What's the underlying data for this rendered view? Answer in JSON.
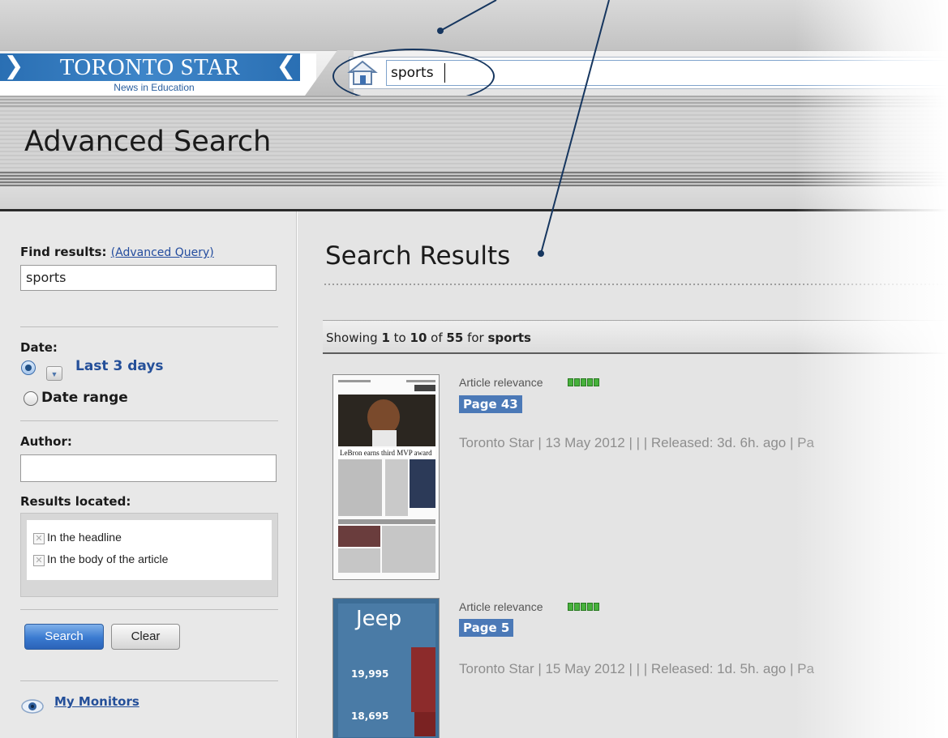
{
  "header": {
    "logo_title": "TORONTO STAR",
    "logo_subtitle": "News in Education",
    "search_value": "sports"
  },
  "page_title": "Advanced Search",
  "sidebar": {
    "find_label": "Find results:",
    "advanced_query_link": "(Advanced Query)",
    "find_value": "sports",
    "date_label": "Date:",
    "date_option_selected": "Last 3 days",
    "date_option_range": "Date range",
    "author_label": "Author:",
    "author_value": "",
    "results_located_label": "Results located:",
    "checkboxes": [
      {
        "label": "In the headline",
        "checked": false
      },
      {
        "label": "In the body of the article",
        "checked": false
      }
    ],
    "search_button": "Search",
    "clear_button": "Clear",
    "monitors_link": "My Monitors"
  },
  "main": {
    "title": "Search Results",
    "showing": {
      "prefix": "Showing",
      "from": "1",
      "to_word": "to",
      "to": "10",
      "of_word": "of",
      "total": "55",
      "for_word": "for",
      "query": "sports"
    },
    "results": [
      {
        "relevance_label": "Article relevance",
        "relevance_level": 5,
        "page": "Page 43",
        "meta": "Toronto Star  |  13 May 2012  |   |   | Released: 3d. 6h. ago  | Pa",
        "thumb_headline": "LeBron earns third MVP award"
      },
      {
        "relevance_label": "Article relevance",
        "relevance_level": 5,
        "page": "Page 5",
        "meta": "Toronto Star  |  15 May 2012  |   |   | Released: 1d. 5h. ago  | Pa",
        "thumb_brand": "Jeep",
        "thumb_price1": "19,995",
        "thumb_price2": "18,695"
      }
    ]
  },
  "colors": {
    "brand_blue": "#3a7bc0",
    "link_blue": "#244f99",
    "relevance_green": "#47b13c",
    "page_badge": "#4b79b7",
    "annotation": "#16365f"
  }
}
